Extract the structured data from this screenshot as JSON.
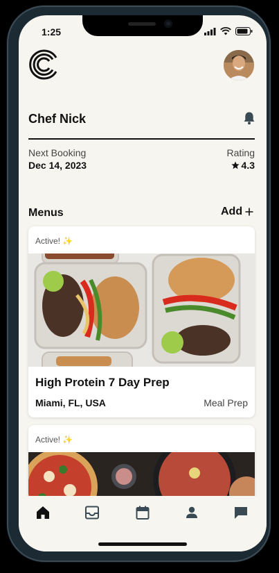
{
  "status": {
    "time": "1:25"
  },
  "profile": {
    "name": "Chef Nick"
  },
  "stats": {
    "next_booking_label": "Next Booking",
    "next_booking_value": "Dec 14, 2023",
    "rating_label": "Rating",
    "rating_value": "4.3"
  },
  "menus": {
    "title": "Menus",
    "add_label": "Add",
    "cards": [
      {
        "status": "Active!",
        "title": "High Protein 7 Day Prep",
        "location": "Miami, FL, USA",
        "category": "Meal Prep"
      },
      {
        "status": "Active!"
      }
    ]
  },
  "tabs": [
    "home-icon",
    "inbox-icon",
    "calendar-icon",
    "profile-icon",
    "chat-icon"
  ],
  "colors": {
    "background": "#f6f5ef",
    "text": "#111111",
    "frame": "#1c2a33",
    "sparkle": "#e6c66a"
  }
}
